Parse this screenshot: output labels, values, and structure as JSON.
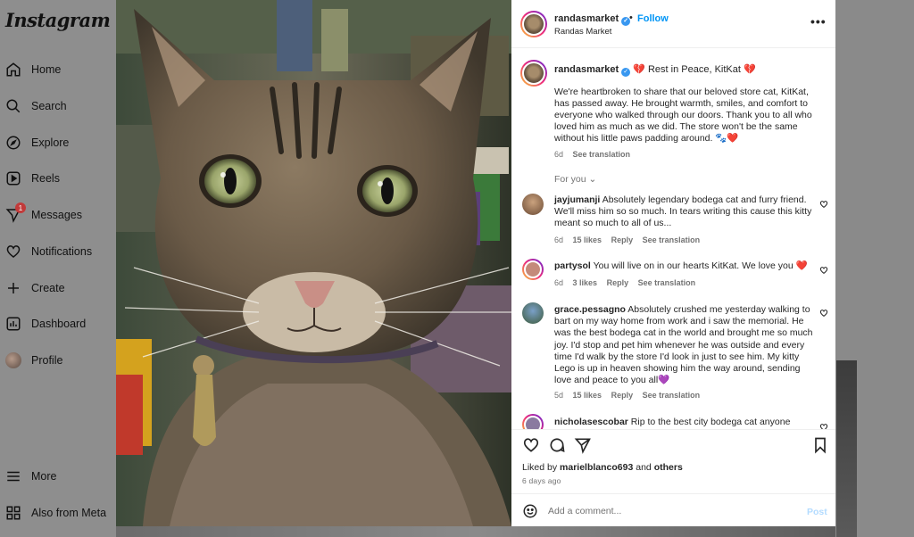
{
  "app": {
    "logo": "Instagram"
  },
  "sidebar": {
    "items": [
      {
        "label": "Home",
        "icon": "home-icon"
      },
      {
        "label": "Search",
        "icon": "search-icon"
      },
      {
        "label": "Explore",
        "icon": "compass-icon"
      },
      {
        "label": "Reels",
        "icon": "reels-icon"
      },
      {
        "label": "Messages",
        "icon": "messages-icon",
        "badge": "1"
      },
      {
        "label": "Notifications",
        "icon": "heart-icon"
      },
      {
        "label": "Create",
        "icon": "plus-icon"
      },
      {
        "label": "Dashboard",
        "icon": "dashboard-icon"
      },
      {
        "label": "Profile",
        "icon": "avatar"
      }
    ],
    "bottom": [
      {
        "label": "More",
        "icon": "menu-icon"
      },
      {
        "label": "Also from Meta",
        "icon": "meta-apps-icon"
      }
    ]
  },
  "post": {
    "username": "randasmarket",
    "follow_label": "Follow",
    "dot": "•",
    "location": "Randas Market",
    "more_label": "•••",
    "caption_title": "💔 Rest in Peace, KitKat 💔",
    "caption": "We're heartbroken to share that our beloved store cat, KitKat, has passed away. He brought warmth, smiles, and comfort to everyone who walked through our doors. Thank you to all who loved him as much as we did. The store won't be the same without his little paws padding around. 🐾❤️",
    "caption_age": "6d",
    "see_translation": "See translation",
    "for_you_label": "For you"
  },
  "comments": [
    {
      "username": "jayjumanji",
      "text": "Absolutely legendary bodega cat and furry friend. We'll miss him so so much. In tears writing this cause this kitty meant so much to all of us...",
      "age": "6d",
      "likes": "15 likes",
      "reply": "Reply",
      "translate": "See translation"
    },
    {
      "username": "partysol",
      "text": "You will live on in our hearts KitKat. We love you ❤️",
      "age": "6d",
      "likes": "3 likes",
      "reply": "Reply",
      "translate": "See translation"
    },
    {
      "username": "grace.pessagno",
      "text": "Absolutely crushed me yesterday walking to bart on my way home from work and i saw the memorial. He was the best bodega cat in the world and brought me so much joy. I'd stop and pet him whenever he was outside and every time I'd walk by the store I'd look in just to see him. My kitty Lego is up in heaven showing him the way around, sending love and peace to you all💜",
      "age": "5d",
      "likes": "15 likes",
      "reply": "Reply",
      "translate": "See translation"
    },
    {
      "username": "nicholasescobar",
      "text": "Rip to the best city bodega cat anyone"
    }
  ],
  "engagement": {
    "liked_by_prefix": "Liked by",
    "liked_by_user": "marielblanco693",
    "and_label": "and",
    "others_label": "others",
    "posted_ago": "6 days ago"
  },
  "add_comment": {
    "placeholder": "Add a comment...",
    "post_label": "Post"
  },
  "colors": {
    "link": "#0095f6",
    "post_disabled": "#b3dbff",
    "verified": "#3897f0",
    "heart": "#ed4956"
  }
}
